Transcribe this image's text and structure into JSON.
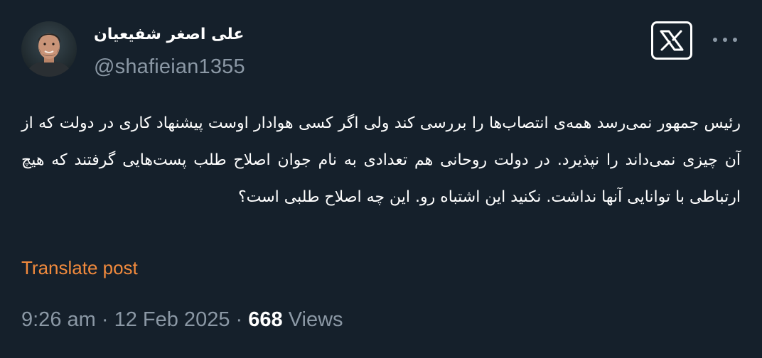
{
  "author": {
    "display_name": "علی اصغر شفیعیان",
    "handle": "@shafieian1355",
    "avatar_icon": "profile-photo"
  },
  "header": {
    "logo_icon": "x-logo-icon",
    "more_icon": "more-dots-icon"
  },
  "tweet": {
    "text": "رئیس جمهور نمی‌رسد همه‌ی انتصاب‌ها را بررسی کند ولی اگر کسی هوادار اوست پیشنهاد کاری در دولت که از آن چیزی نمی‌داند را نپذیرد. در دولت روحانی هم تعدادی به نام جوان اصلاح طلب پست‌هایی گرفتند که هیچ ارتباطی با توانایی آنها نداشت. نکنید این اشتباه رو. این چه اصلاح طلبی است؟",
    "translate_label": "Translate post"
  },
  "meta": {
    "time": "9:26 am",
    "separator": "·",
    "date": "12 Feb 2025",
    "views_count": "668",
    "views_label": "Views"
  },
  "colors": {
    "background": "#15202b",
    "text": "#ffffff",
    "secondary": "#8b98a5",
    "translate": "#f18a3d"
  }
}
